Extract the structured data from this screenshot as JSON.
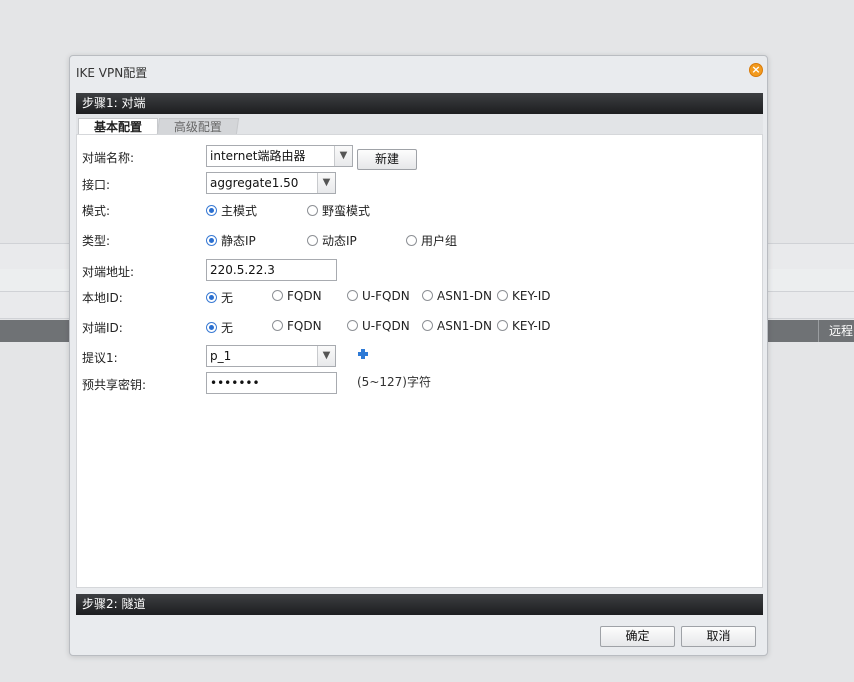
{
  "background": {
    "column_header": "远程"
  },
  "dialog": {
    "title": "IKE VPN配置",
    "step1": "步骤1: 对端",
    "step2": "步骤2: 隧道",
    "tabs": {
      "basic": "基本配置",
      "advanced": "高级配置"
    },
    "form": {
      "peer_name": {
        "label": "对端名称:",
        "value": "internet端路由器",
        "new_button": "新建"
      },
      "interface": {
        "label": "接口:",
        "value": "aggregate1.50"
      },
      "mode": {
        "label": "模式:",
        "options": [
          "主模式",
          "野蛮模式"
        ],
        "selected": "主模式"
      },
      "type": {
        "label": "类型:",
        "options": [
          "静态IP",
          "动态IP",
          "用户组"
        ],
        "selected": "静态IP"
      },
      "peer_address": {
        "label": "对端地址:",
        "value": "220.5.22.3"
      },
      "local_id": {
        "label": "本地ID:",
        "options": [
          "无",
          "FQDN",
          "U-FQDN",
          "ASN1-DN",
          "KEY-ID"
        ],
        "selected": "无"
      },
      "peer_id": {
        "label": "对端ID:",
        "options": [
          "无",
          "FQDN",
          "U-FQDN",
          "ASN1-DN",
          "KEY-ID"
        ],
        "selected": "无"
      },
      "proposal1": {
        "label": "提议1:",
        "value": "p_1",
        "add_icon": "plus-icon"
      },
      "psk": {
        "label": "预共享密钥:",
        "value": "•••••••",
        "hint": "(5~127)字符"
      }
    },
    "buttons": {
      "ok": "确定",
      "cancel": "取消"
    }
  }
}
